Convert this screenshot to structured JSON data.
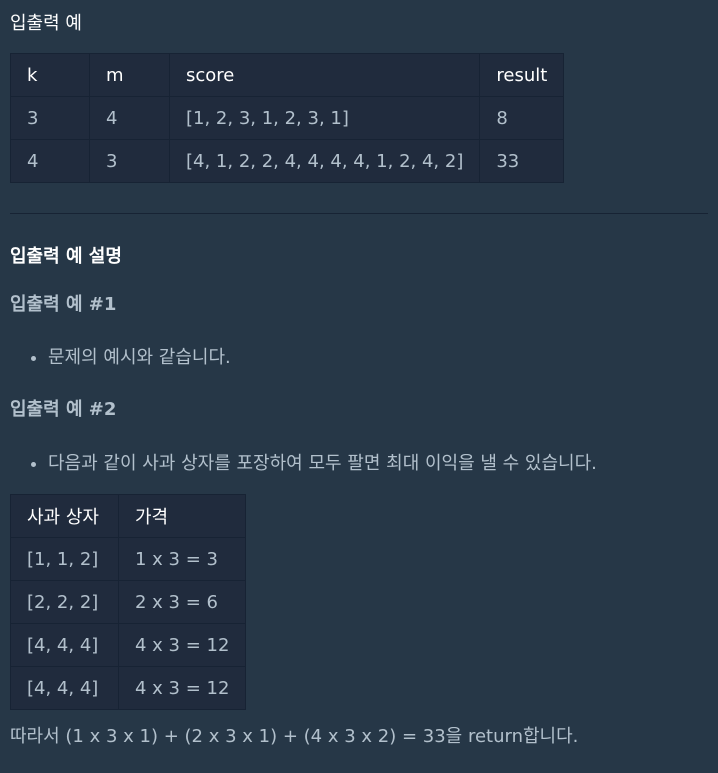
{
  "section_title": "입출력 예",
  "examples": {
    "headers": [
      "k",
      "m",
      "score",
      "result"
    ],
    "rows": [
      [
        "3",
        "4",
        "[1, 2, 3, 1, 2, 3, 1]",
        "8"
      ],
      [
        "4",
        "3",
        "[4, 1, 2, 2, 4, 4, 4, 4, 1, 2, 4, 2]",
        "33"
      ]
    ]
  },
  "explanation_title": "입출력 예 설명",
  "case1": {
    "title": "입출력 예 #1",
    "bullet": "문제의 예시와 같습니다."
  },
  "case2": {
    "title": "입출력 예 #2",
    "bullet": "다음과 같이 사과 상자를 포장하여 모두 팔면 최대 이익을 낼 수 있습니다.",
    "table": {
      "headers": [
        "사과 상자",
        "가격"
      ],
      "rows": [
        [
          "[1, 1, 2]",
          "1 x 3 = 3"
        ],
        [
          "[2, 2, 2]",
          "2 x 3 = 6"
        ],
        [
          "[4, 4, 4]",
          "4 x 3 = 12"
        ],
        [
          "[4, 4, 4]",
          "4 x 3 = 12"
        ]
      ]
    },
    "conclusion": "따라서 (1 x 3 x 1) + (2 x 3 x 1) + (4 x 3 x 2) = 33을 return합니다."
  },
  "colors": {
    "background": "#263747",
    "table_background": "#202b3d",
    "border": "#172334",
    "text": "#b2c0cc",
    "heading": "#ffffff"
  }
}
